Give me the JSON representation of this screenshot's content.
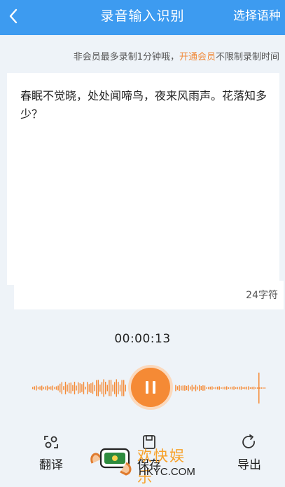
{
  "header": {
    "title": "录音输入识别",
    "language_button": "选择语种"
  },
  "notice": {
    "prefix": "非会员最多录制1分钟哦，",
    "link": "开通会员",
    "suffix": "不限制录制时间"
  },
  "transcript": {
    "text": "春眠不觉晓，处处闻啼鸟，夜来风雨声。花落知多少？",
    "char_count": "24字符"
  },
  "recording": {
    "elapsed": "00:00:13",
    "state": "recording"
  },
  "toolbar": {
    "translate_label": "翻译",
    "save_label": "保存",
    "export_label": "导出"
  },
  "watermark": {
    "text": "欢快娱乐",
    "site": "HKYC.COM"
  },
  "colors": {
    "header": "#3d9bf0",
    "accent": "#f58a35",
    "background": "#eef3f8"
  }
}
